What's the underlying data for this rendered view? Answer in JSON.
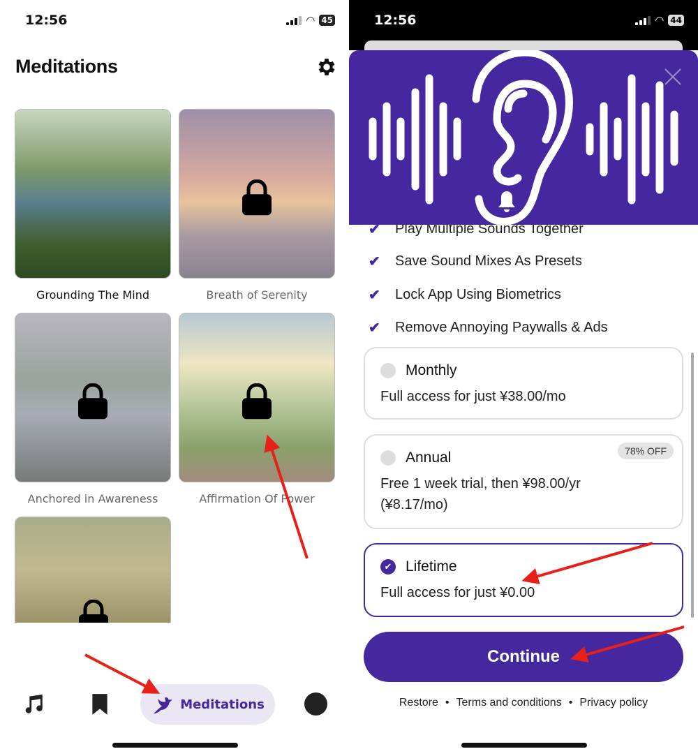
{
  "left": {
    "status": {
      "time": "12:56",
      "battery": "45"
    },
    "title": "Meditations",
    "settings_icon": "gear-icon",
    "cards": [
      {
        "label": "Grounding The Mind",
        "locked": false
      },
      {
        "label": "Breath of Serenity",
        "locked": true
      },
      {
        "label": "Anchored in Awareness",
        "locked": true
      },
      {
        "label": "Affirmation Of Power",
        "locked": true
      },
      {
        "label": "",
        "locked": true
      }
    ],
    "nav": {
      "music_icon": "music-note-icon",
      "bookmark_icon": "bookmark-icon",
      "meditations_label": "Meditations",
      "profile_icon": "circle-icon"
    }
  },
  "right": {
    "status": {
      "time": "12:56",
      "battery": "44"
    },
    "features": [
      "Play Multiple Sounds Together",
      "Save Sound Mixes As Presets",
      "Lock App Using Biometrics",
      "Remove Annoying Paywalls & Ads"
    ],
    "plans": [
      {
        "name": "Monthly",
        "desc": "Full access for just ¥38.00/mo",
        "selected": false
      },
      {
        "name": "Annual",
        "desc": "Free 1 week trial, then ¥98.00/yr",
        "desc2": "(¥8.17/mo)",
        "badge": "78% OFF",
        "selected": false
      },
      {
        "name": "Lifetime",
        "desc": "Full access for just ¥0.00",
        "selected": true
      }
    ],
    "continue_label": "Continue",
    "footer": {
      "restore": "Restore",
      "sep": "•",
      "terms": "Terms and conditions",
      "privacy": "Privacy policy"
    }
  },
  "colors": {
    "accent": "#4527a0",
    "annotation": "#e8201a"
  }
}
